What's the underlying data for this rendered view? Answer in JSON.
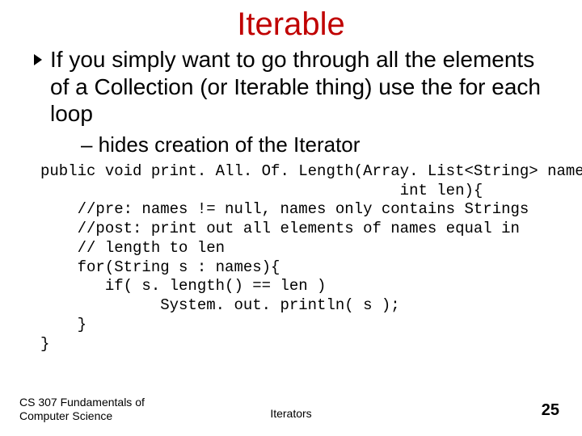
{
  "title": "Iterable",
  "bullet": "If you simply want to go through all the elements of a Collection (or Iterable thing) use the for each loop",
  "sub": "– hides creation of the Iterator",
  "code": "public void print. All. Of. Length(Array. List<String> names,\n                                       int len){\n    //pre: names != null, names only contains Strings\n    //post: print out all elements of names equal in\n    // length to len\n    for(String s : names){\n       if( s. length() == len )\n             System. out. println( s );\n    }\n}",
  "footer": {
    "left": "CS 307 Fundamentals of Computer Science",
    "center": "Iterators",
    "page": "25"
  }
}
